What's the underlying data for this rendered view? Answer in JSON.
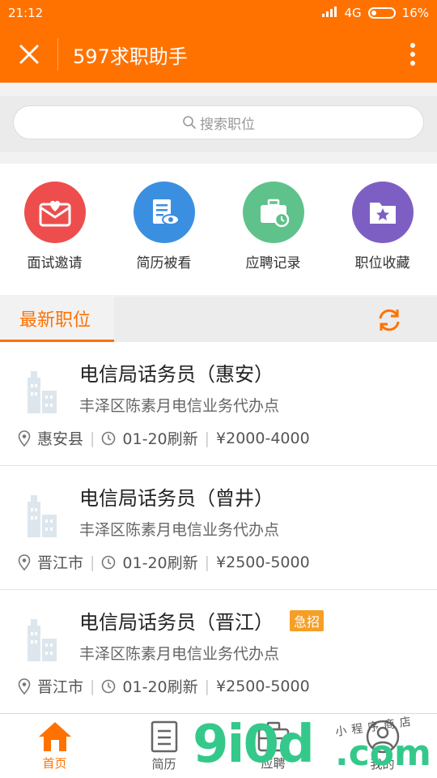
{
  "status": {
    "time": "21:12",
    "network": "4G",
    "battery": "16%"
  },
  "appbar": {
    "title": "597求职助手"
  },
  "search": {
    "placeholder": "搜索职位"
  },
  "quick_actions": [
    {
      "label": "面试邀请",
      "color": "#ee4d4d",
      "icon": "envelope-heart-icon"
    },
    {
      "label": "简历被看",
      "color": "#3b8fe0",
      "icon": "resume-eye-icon"
    },
    {
      "label": "应聘记录",
      "color": "#5fc28b",
      "icon": "briefcase-clock-icon"
    },
    {
      "label": "职位收藏",
      "color": "#7d5fc4",
      "icon": "folder-star-icon"
    }
  ],
  "section": {
    "title": "最新职位"
  },
  "jobs": [
    {
      "title": "电信局话务员（惠安）",
      "company": "丰泽区陈素月电信业务代办点",
      "location": "惠安县",
      "refresh": "01-20刷新",
      "salary": "¥2000-4000",
      "urgent": ""
    },
    {
      "title": "电信局话务员（曾井）",
      "company": "丰泽区陈素月电信业务代办点",
      "location": "晋江市",
      "refresh": "01-20刷新",
      "salary": "¥2500-5000",
      "urgent": ""
    },
    {
      "title": "电信局话务员（晋江）",
      "company": "丰泽区陈素月电信业务代办点",
      "location": "晋江市",
      "refresh": "01-20刷新",
      "salary": "¥2500-5000",
      "urgent": "急招"
    }
  ],
  "tabs": [
    {
      "label": "首页",
      "icon": "home-icon"
    },
    {
      "label": "简历",
      "icon": "document-icon"
    },
    {
      "label": "应聘",
      "icon": "briefcase-icon"
    },
    {
      "label": "我的",
      "icon": "user-icon"
    }
  ],
  "watermark": {
    "main": "9i0d",
    "suffix": ".com",
    "small": "小程序商店"
  },
  "colors": {
    "primary": "#ff7200",
    "urgent": "#f59f26"
  }
}
